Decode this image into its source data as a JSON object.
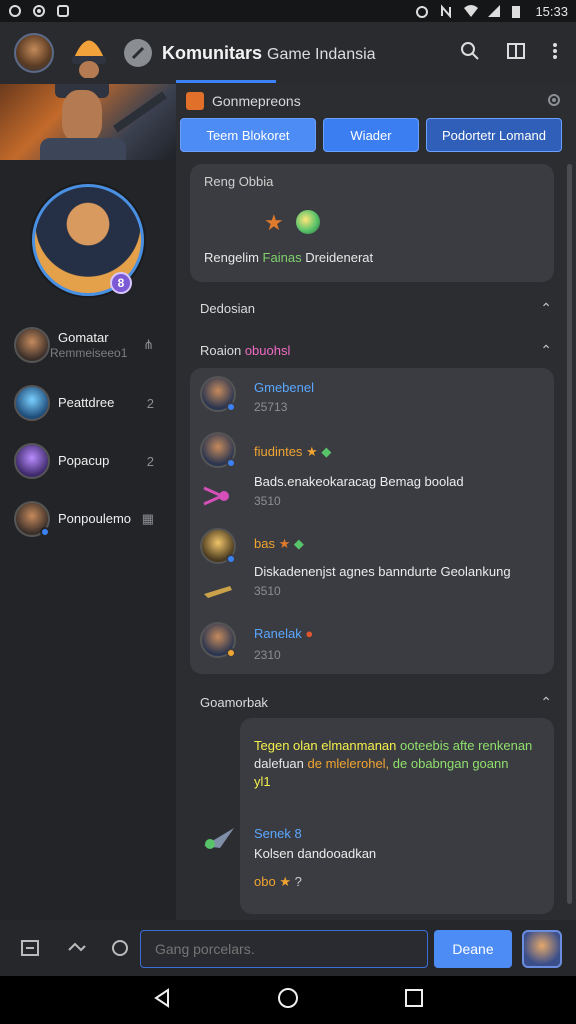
{
  "status_bar": {
    "time": "15:33"
  },
  "header": {
    "title": "Komunitars",
    "subtitle": "Game Indansia"
  },
  "channel": {
    "name": "Gonmepreons"
  },
  "tabs": [
    "Teem Blokoret",
    "Wiader",
    "Podortetr Lomand"
  ],
  "sidebar": {
    "friends": [
      {
        "name": "Gomatar",
        "sub": "Remmeiseeo1",
        "count": ""
      },
      {
        "name": "Peattdree",
        "sub": "",
        "count": "2"
      },
      {
        "name": "Popacup",
        "sub": "",
        "count": "2"
      },
      {
        "name": "Ponpoulemo",
        "sub": "",
        "count": ""
      }
    ]
  },
  "card1": {
    "label": "Reng Obbia",
    "line_a": "Rengelim",
    "line_b": "Fainas",
    "line_c": "Dreidenerat"
  },
  "sections": {
    "s1": "Dedosian",
    "s2_a": "Roaion",
    "s2_b": "obuohsl",
    "s3": "Goamorbak"
  },
  "messages": [
    {
      "name": "Gmebenel",
      "time": "25713"
    },
    {
      "name": "fiudintes",
      "text": "Bads.enakeokaracag Bemag boolad",
      "time": "3510"
    },
    {
      "name": "bas",
      "text": "Diskadenenjst agnes banndurte Geolankung",
      "time": "3510"
    },
    {
      "name": "Ranelak",
      "time": "2310"
    }
  ],
  "card3": {
    "ln1_a": "Tegen olan elmanmanan",
    "ln1_b": "ooteebis afte renkenan",
    "ln2_a": "dalefuan",
    "ln2_b": "de mlelerohel,",
    "ln2_c": "de obabngan goann",
    "ln3": "yl1",
    "name": "Senek 8",
    "text": "Kolsen dandooadkan",
    "react": "obo"
  },
  "composer": {
    "placeholder": "Gang porcelars.",
    "send_label": "Deane"
  },
  "colors": {
    "accent": "#4d8cf5",
    "pink": "#f06ac4",
    "orange": "#f0a431",
    "green": "#8fe06d",
    "yellow": "#f4f14d"
  },
  "icons": [
    "search-icon",
    "layout-icon",
    "more-icon",
    "settings-icon",
    "star-icon",
    "chevron-up-icon"
  ]
}
